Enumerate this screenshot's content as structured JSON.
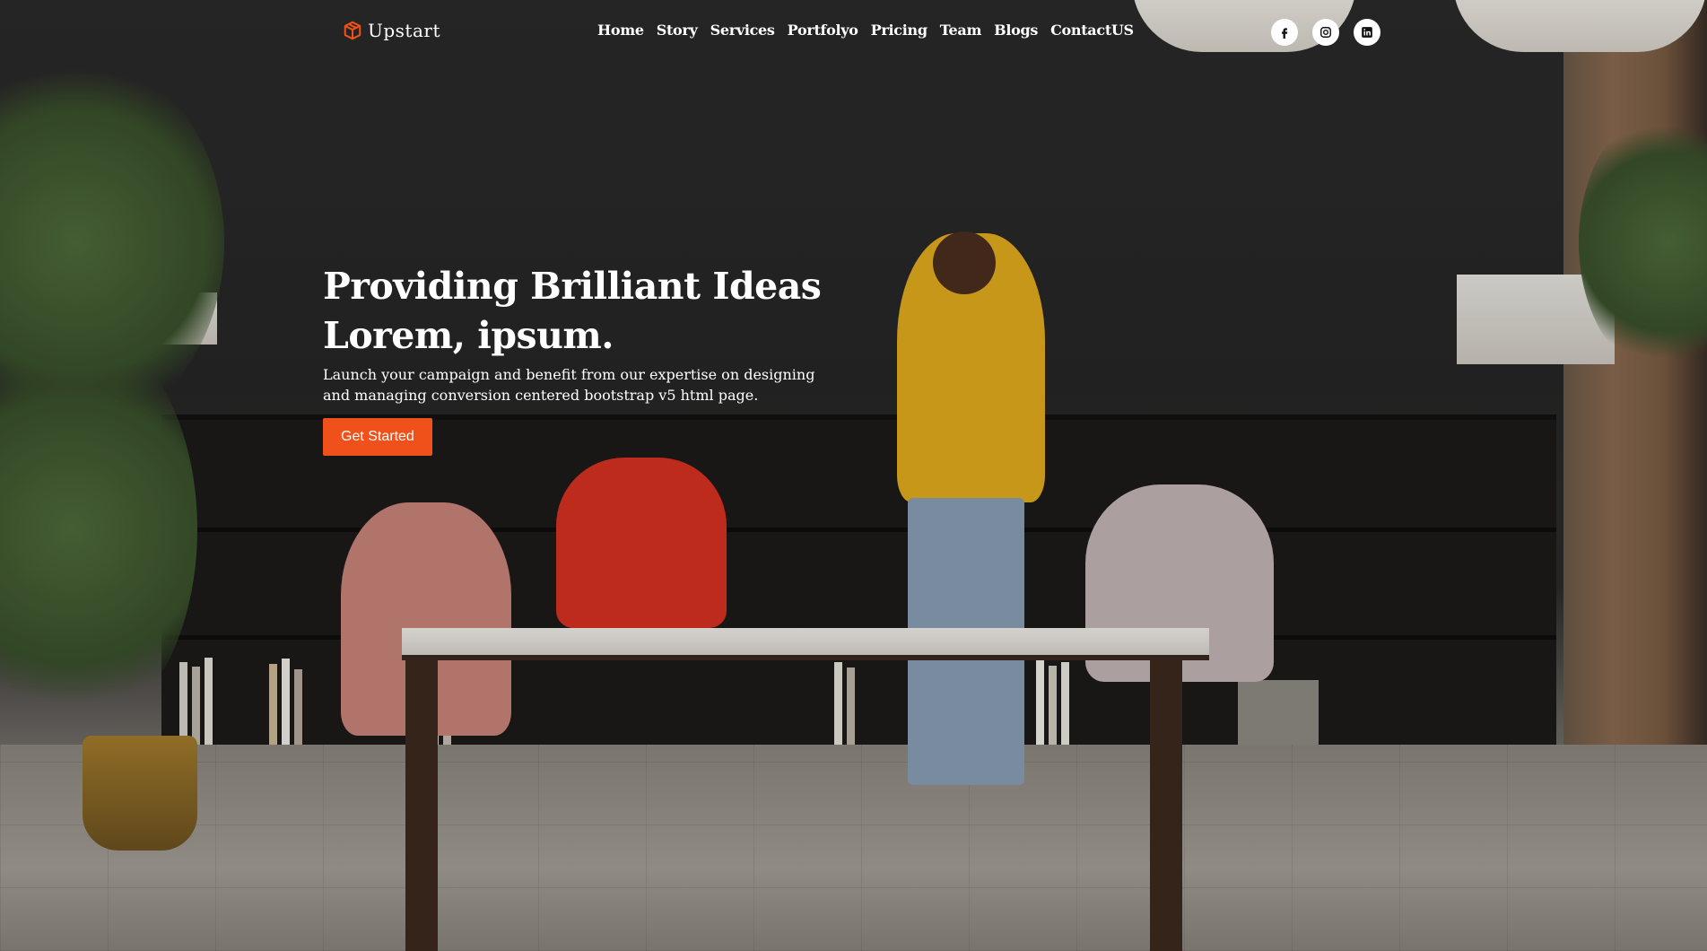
{
  "brand": {
    "name": "Upstart",
    "accent_color": "#f0511a",
    "icon": "box-logo-icon"
  },
  "nav": {
    "items": [
      {
        "label": "Home"
      },
      {
        "label": "Story"
      },
      {
        "label": "Services"
      },
      {
        "label": "Portfolyo"
      },
      {
        "label": "Pricing"
      },
      {
        "label": "Team"
      },
      {
        "label": "Blogs"
      },
      {
        "label": "ContactUS"
      }
    ]
  },
  "socials": [
    {
      "icon": "facebook-icon"
    },
    {
      "icon": "instagram-icon"
    },
    {
      "icon": "linkedin-icon"
    }
  ],
  "hero": {
    "title_line1": "Providing Brilliant Ideas",
    "title_line2": "Lorem, ipsum.",
    "description": "Launch your campaign and benefit from our expertise on designing and managing conversion centered bootstrap v5 html page.",
    "cta_label": "Get Started"
  }
}
